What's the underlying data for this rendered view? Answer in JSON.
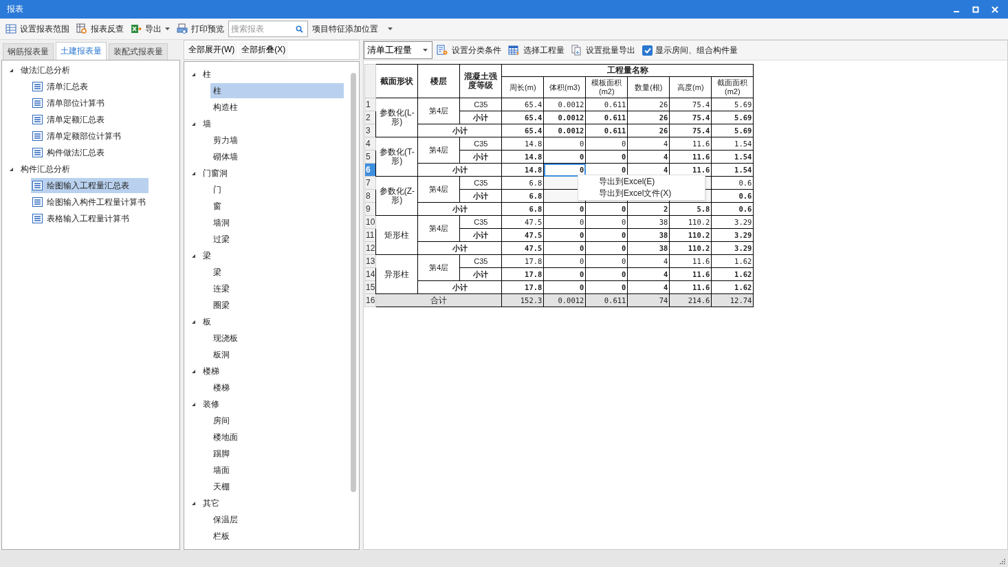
{
  "window": {
    "title": "报表"
  },
  "toolbar": [
    {
      "label": "设置报表范围",
      "kind": "range"
    },
    {
      "label": "报表反查",
      "kind": "lookup"
    },
    {
      "label": "导出",
      "kind": "export",
      "dropdown": true
    },
    {
      "label": "打印预览",
      "kind": "print"
    }
  ],
  "search": {
    "placeholder": "搜索报表"
  },
  "position_dropdown": {
    "value": "项目特征添加位置"
  },
  "left_tabs": [
    {
      "label": "钢筋报表量",
      "selected": false
    },
    {
      "label": "土建报表量",
      "selected": true
    },
    {
      "label": "装配式报表量",
      "selected": false
    }
  ],
  "report_tree": [
    {
      "label": "做法汇总分析",
      "expanded": true,
      "children": [
        {
          "label": "清单汇总表",
          "selected": false
        },
        {
          "label": "清单部位计算书",
          "selected": false
        },
        {
          "label": "清单定额汇总表",
          "selected": false
        },
        {
          "label": "清单定额部位计算书",
          "selected": false
        },
        {
          "label": "构件做法汇总表",
          "selected": false
        }
      ]
    },
    {
      "label": "构件汇总分析",
      "expanded": true,
      "children": [
        {
          "label": "绘图输入工程量汇总表",
          "selected": true
        },
        {
          "label": "绘图输入构件工程量计算书",
          "selected": false
        },
        {
          "label": "表格输入工程量计算书",
          "selected": false
        }
      ]
    }
  ],
  "middle_buttons": [
    "全部展开(W)",
    "全部折叠(X)"
  ],
  "component_tree": [
    {
      "label": "柱",
      "expanded": true,
      "children": [
        {
          "label": "柱",
          "selected": true
        },
        {
          "label": "构造柱",
          "selected": false
        }
      ]
    },
    {
      "label": "墙",
      "expanded": true,
      "children": [
        {
          "label": "剪力墙",
          "selected": false
        },
        {
          "label": "砌体墙",
          "selected": false
        }
      ]
    },
    {
      "label": "门窗洞",
      "expanded": true,
      "children": [
        {
          "label": "门",
          "selected": false
        },
        {
          "label": "窗",
          "selected": false
        },
        {
          "label": "墙洞",
          "selected": false
        },
        {
          "label": "过梁",
          "selected": false
        }
      ]
    },
    {
      "label": "梁",
      "expanded": true,
      "children": [
        {
          "label": "梁",
          "selected": false
        },
        {
          "label": "连梁",
          "selected": false
        },
        {
          "label": "圈梁",
          "selected": false
        }
      ]
    },
    {
      "label": "板",
      "expanded": true,
      "children": [
        {
          "label": "现浇板",
          "selected": false
        },
        {
          "label": "板洞",
          "selected": false
        }
      ]
    },
    {
      "label": "楼梯",
      "expanded": true,
      "children": [
        {
          "label": "楼梯",
          "selected": false
        }
      ]
    },
    {
      "label": "装修",
      "expanded": true,
      "children": [
        {
          "label": "房间",
          "selected": false
        },
        {
          "label": "楼地面",
          "selected": false
        },
        {
          "label": "踢脚",
          "selected": false
        },
        {
          "label": "墙面",
          "selected": false
        },
        {
          "label": "天棚",
          "selected": false
        }
      ]
    },
    {
      "label": "其它",
      "expanded": true,
      "children": [
        {
          "label": "保温层",
          "selected": false
        },
        {
          "label": "栏板",
          "selected": false
        }
      ]
    }
  ],
  "right_toolbar": {
    "mode_dropdown": "清单工程量",
    "buttons": [
      {
        "label": "设置分类条件",
        "kind": "classify"
      },
      {
        "label": "选择工程量",
        "kind": "select"
      },
      {
        "label": "设置批量导出",
        "kind": "batch"
      }
    ],
    "checkbox": {
      "label": "显示房间、组合构件量",
      "checked": true
    }
  },
  "table": {
    "fixed_columns": [
      "截面形状",
      "楼层",
      "混凝土强度等级"
    ],
    "group_header": "工程量名称",
    "columns": [
      "周长(m)",
      "体积(m3)",
      "模板面积(m2)",
      "数量(根)",
      "高度(m)",
      "截面面积(m2)"
    ],
    "groups": [
      {
        "shape": "参数化(L-形)",
        "floor": "第4层",
        "rows": [
          {
            "num": "1",
            "kind": "detail",
            "label": "C35",
            "selected": false,
            "values": [
              "65.4",
              "0.0012",
              "0.611",
              "26",
              "75.4",
              "5.69"
            ],
            "selected_cells": [
              false,
              false,
              false,
              false,
              false,
              false
            ]
          },
          {
            "num": "2",
            "kind": "floor_subtotal",
            "label": "小计",
            "selected": false,
            "values": [
              "65.4",
              "0.0012",
              "0.611",
              "26",
              "75.4",
              "5.69"
            ],
            "selected_cells": [
              false,
              false,
              false,
              false,
              false,
              false
            ]
          },
          {
            "num": "3",
            "kind": "shape_subtotal",
            "label": "小计",
            "selected": false,
            "values": [
              "65.4",
              "0.0012",
              "0.611",
              "26",
              "75.4",
              "5.69"
            ],
            "selected_cells": [
              false,
              false,
              false,
              false,
              false,
              false
            ]
          }
        ]
      },
      {
        "shape": "参数化(T-形)",
        "floor": "第4层",
        "rows": [
          {
            "num": "4",
            "kind": "detail",
            "label": "C35",
            "selected": false,
            "values": [
              "14.8",
              "0",
              "0",
              "4",
              "11.6",
              "1.54"
            ],
            "selected_cells": [
              false,
              false,
              false,
              false,
              false,
              false
            ]
          },
          {
            "num": "5",
            "kind": "floor_subtotal",
            "label": "小计",
            "selected": false,
            "values": [
              "14.8",
              "0",
              "0",
              "4",
              "11.6",
              "1.54"
            ],
            "selected_cells": [
              false,
              false,
              false,
              false,
              false,
              false
            ]
          },
          {
            "num": "6",
            "kind": "shape_subtotal",
            "label": "小计",
            "selected": true,
            "values": [
              "14.8",
              "0",
              "0",
              "4",
              "11.6",
              "1.54"
            ],
            "selected_cells": [
              false,
              true,
              false,
              false,
              false,
              false
            ]
          }
        ]
      },
      {
        "shape": "参数化(Z-形)",
        "floor": "第4层",
        "rows": [
          {
            "num": "7",
            "kind": "detail",
            "label": "C35",
            "selected": false,
            "menu_covered": true,
            "values": [
              "6.8",
              "0.6"
            ],
            "selected_cells": [
              false,
              false
            ]
          },
          {
            "num": "8",
            "kind": "floor_subtotal",
            "label": "小计",
            "selected": false,
            "menu_covered": true,
            "values": [
              "6.8",
              "0.6"
            ],
            "selected_cells": [
              false,
              false
            ]
          },
          {
            "num": "9",
            "kind": "shape_subtotal",
            "label": "小计",
            "selected": false,
            "values": [
              "6.8",
              "0",
              "0",
              "2",
              "5.8",
              "0.6"
            ],
            "selected_cells": [
              false,
              false,
              false,
              false,
              false,
              false
            ]
          }
        ]
      },
      {
        "shape": "矩形柱",
        "floor": "第4层",
        "rows": [
          {
            "num": "10",
            "kind": "detail",
            "label": "C35",
            "selected": false,
            "values": [
              "47.5",
              "0",
              "0",
              "38",
              "110.2",
              "3.29"
            ],
            "selected_cells": [
              false,
              false,
              false,
              false,
              false,
              false
            ]
          },
          {
            "num": "11",
            "kind": "floor_subtotal",
            "label": "小计",
            "selected": false,
            "values": [
              "47.5",
              "0",
              "0",
              "38",
              "110.2",
              "3.29"
            ],
            "selected_cells": [
              false,
              false,
              false,
              false,
              false,
              false
            ]
          },
          {
            "num": "12",
            "kind": "shape_subtotal",
            "label": "小计",
            "selected": false,
            "values": [
              "47.5",
              "0",
              "0",
              "38",
              "110.2",
              "3.29"
            ],
            "selected_cells": [
              false,
              false,
              false,
              false,
              false,
              false
            ]
          }
        ]
      },
      {
        "shape": "异形柱",
        "floor": "第4层",
        "rows": [
          {
            "num": "13",
            "kind": "detail",
            "label": "C35",
            "selected": false,
            "values": [
              "17.8",
              "0",
              "0",
              "4",
              "11.6",
              "1.62"
            ],
            "selected_cells": [
              false,
              false,
              false,
              false,
              false,
              false
            ]
          },
          {
            "num": "14",
            "kind": "floor_subtotal",
            "label": "小计",
            "selected": false,
            "values": [
              "17.8",
              "0",
              "0",
              "4",
              "11.6",
              "1.62"
            ],
            "selected_cells": [
              false,
              false,
              false,
              false,
              false,
              false
            ]
          },
          {
            "num": "15",
            "kind": "shape_subtotal",
            "label": "小计",
            "selected": false,
            "values": [
              "17.8",
              "0",
              "0",
              "4",
              "11.6",
              "1.62"
            ],
            "selected_cells": [
              false,
              false,
              false,
              false,
              false,
              false
            ]
          }
        ]
      }
    ],
    "total": {
      "num": "16",
      "label": "合计",
      "values": [
        "152.3",
        "0.0012",
        "0.611",
        "74",
        "214.6",
        "12.74"
      ]
    }
  },
  "context_menu": [
    "导出到Excel(E)",
    "导出到Excel文件(X)"
  ]
}
